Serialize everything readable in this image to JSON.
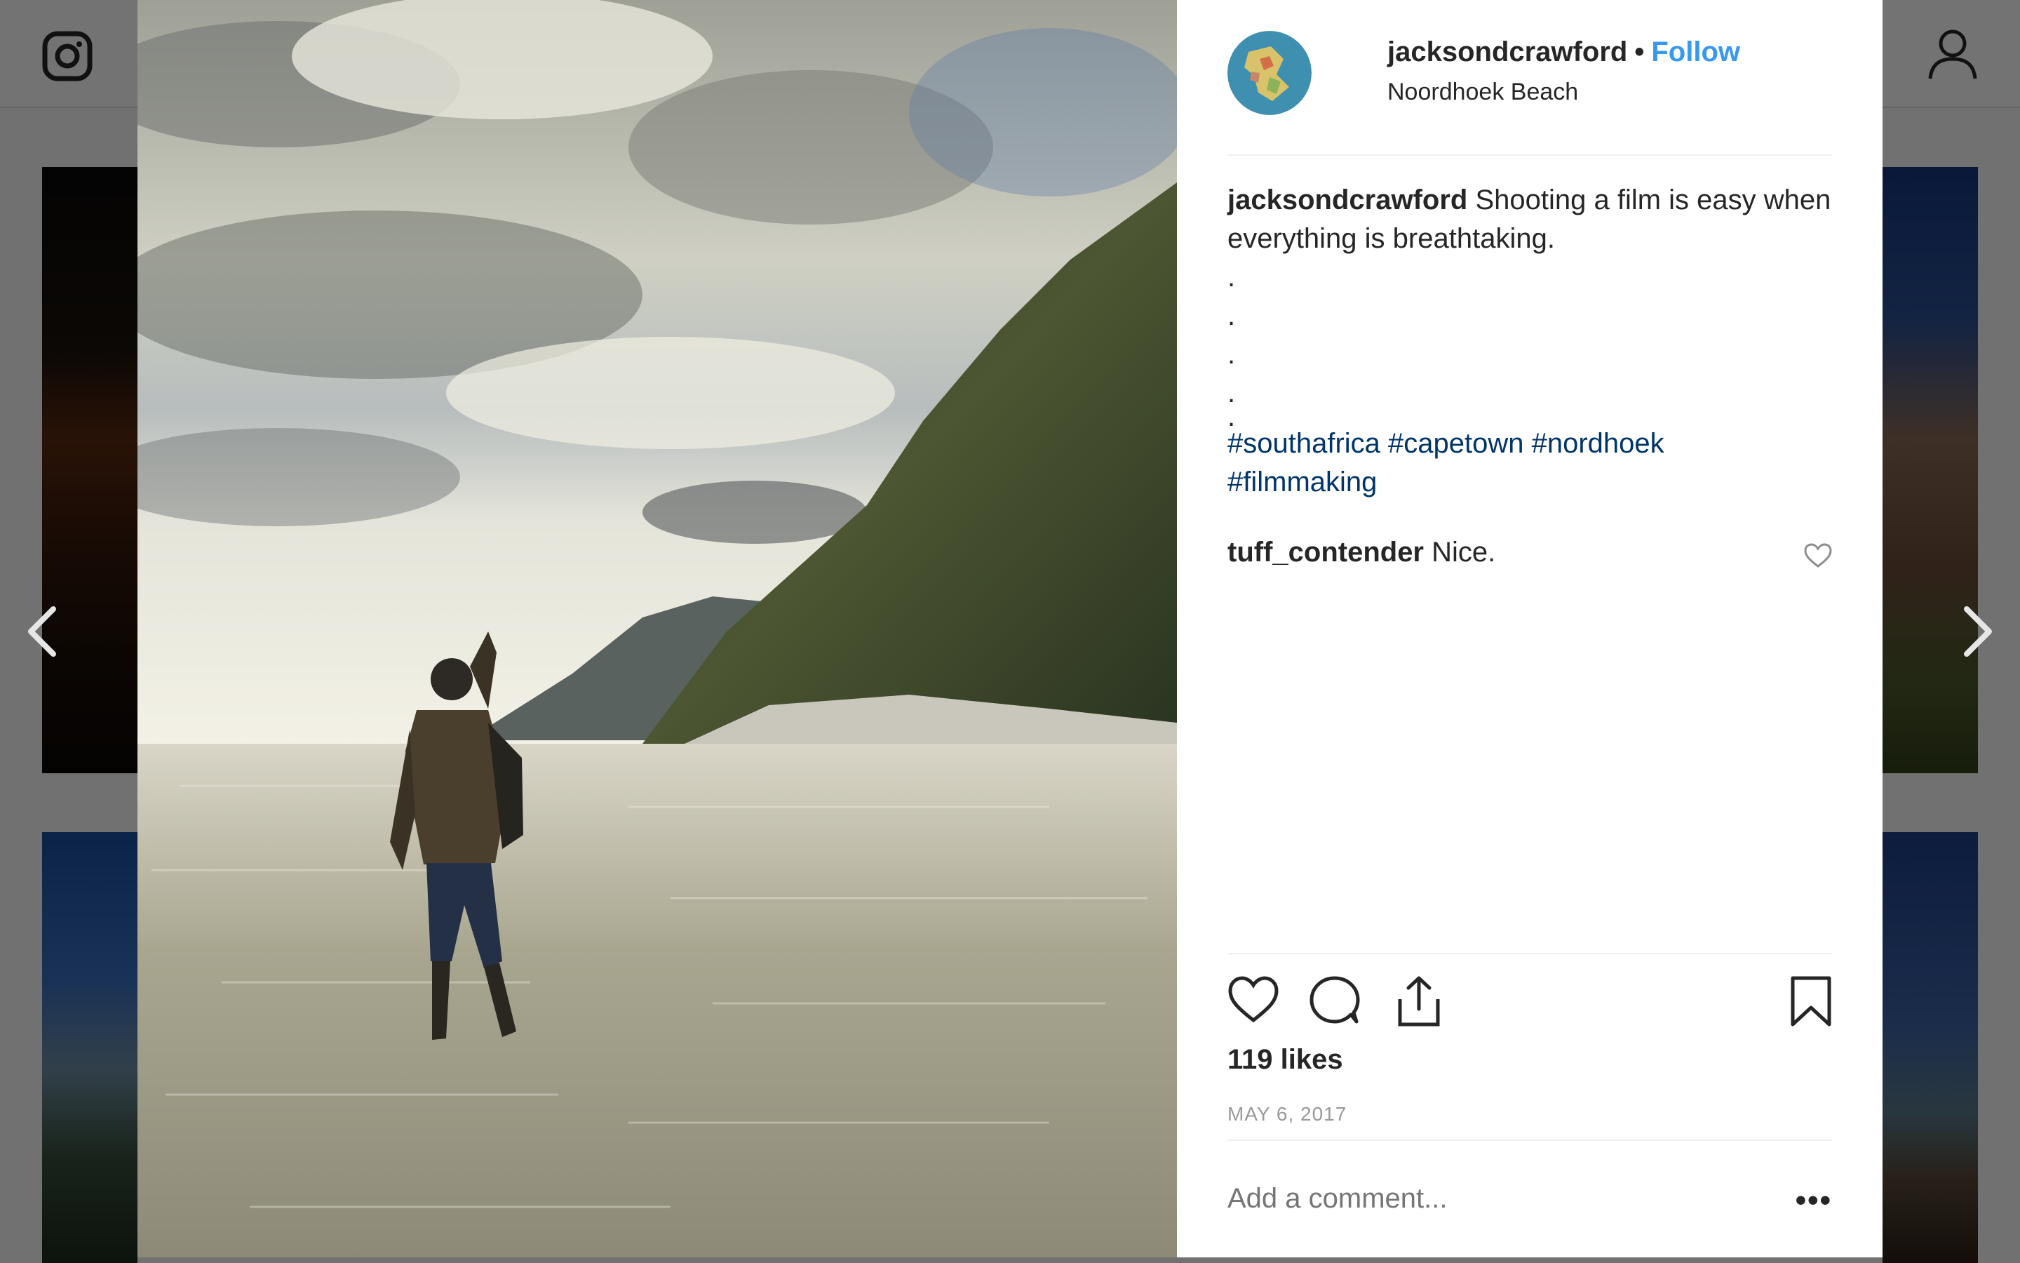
{
  "post": {
    "username": "jacksondcrawford",
    "follow_label": "Follow",
    "separator": "•",
    "location": "Noordhoek Beach",
    "caption": {
      "user": "jacksondcrawford",
      "text": "Shooting a film is easy when everything is breathtaking.",
      "dots": [
        ".",
        ".",
        ".",
        ".",
        "."
      ],
      "hashtags_line1": "#southafrica #capetown #nordhoek",
      "hashtags_line2": "#filmmaking"
    },
    "comment": {
      "user": "tuff_contender",
      "text": "Nice."
    },
    "likes": "119 likes",
    "date": "MAY 6, 2017",
    "add_comment_placeholder": "Add a comment...",
    "more_label": "•••"
  },
  "colors": {
    "link_blue": "#3897f0",
    "hashtag": "#003569",
    "text": "#262626",
    "muted": "#999999"
  },
  "icons": [
    "instagram-icon",
    "profile-icon",
    "chevron-left-icon",
    "chevron-right-icon",
    "heart-icon",
    "comment-icon",
    "share-icon",
    "bookmark-icon",
    "small-heart-icon"
  ]
}
